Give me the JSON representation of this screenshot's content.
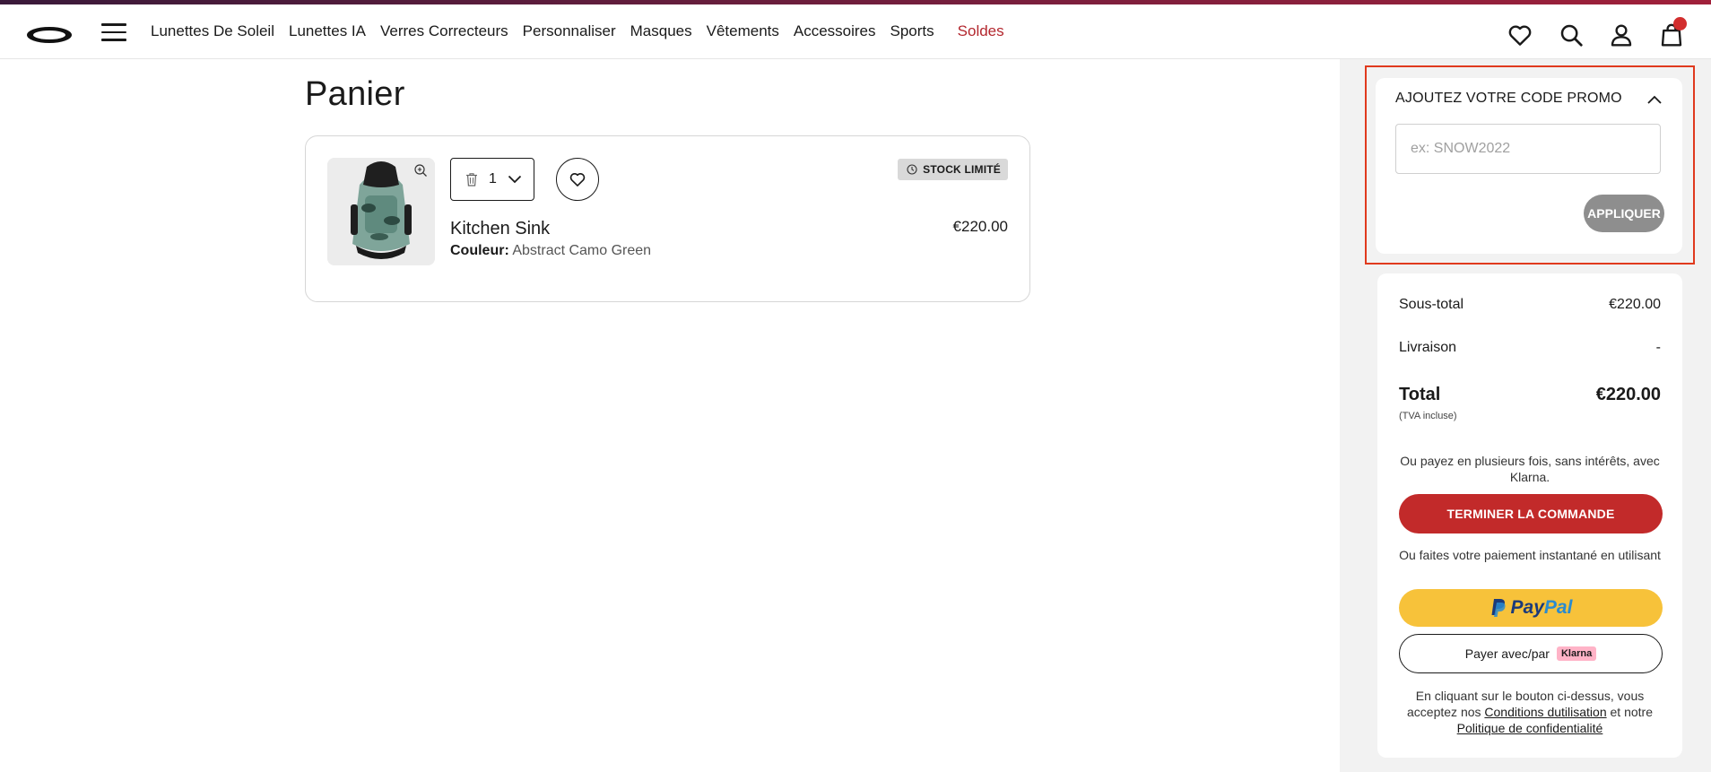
{
  "nav": {
    "items": [
      "Lunettes De Soleil",
      "Lunettes IA",
      "Verres Correcteurs",
      "Personnaliser",
      "Masques",
      "Vêtements",
      "Accessoires",
      "Sports"
    ],
    "sale": "Soldes"
  },
  "icons": {
    "logo": "oakley-ellipse-logo",
    "menu": "hamburger-icon",
    "wishlist": "heart-icon",
    "search": "search-icon",
    "account": "user-icon",
    "cart": "bag-icon"
  },
  "page": {
    "title": "Panier"
  },
  "cart_item": {
    "qty": "1",
    "stock_badge": "STOCK LIMITÉ",
    "name": "Kitchen Sink",
    "color_label": "Couleur:",
    "color_value": "Abstract Camo Green",
    "price": "€220.00"
  },
  "promo": {
    "title": "AJOUTEZ VOTRE CODE PROMO",
    "placeholder": "ex: SNOW2022",
    "apply": "APPLIQUER"
  },
  "summary": {
    "subtotal_label": "Sous-total",
    "subtotal_value": "€220.00",
    "shipping_label": "Livraison",
    "shipping_value": "-",
    "total_label": "Total",
    "total_value": "€220.00",
    "tva": "(TVA incluse)",
    "klarna_note_1": "Ou payez en plusieurs fois, sans intérêts, avec",
    "klarna_note_2": "Klarna.",
    "checkout": "TERMINER LA COMMANDE",
    "instant_note": "Ou faites votre paiement instantané en utilisant",
    "paypal_1": "Pay",
    "paypal_2": "Pal",
    "klarna_button": "Payer avec/par",
    "klarna_badge": "Klarna",
    "legal_1": "En cliquant sur le bouton ci-dessus, vous acceptez nos",
    "legal_link_1": "Conditions dutilisation",
    "legal_2": "et notre",
    "legal_link_2": "Politique de confidentialité"
  },
  "colors": {
    "accent_red": "#c22a2a",
    "sale_red": "#b3272e",
    "paypal_yellow": "#f7c23a",
    "klarna_pink": "#ffb3c7",
    "highlight_outline": "#e03a1e",
    "sidebar_bg": "#f2f2f2"
  }
}
